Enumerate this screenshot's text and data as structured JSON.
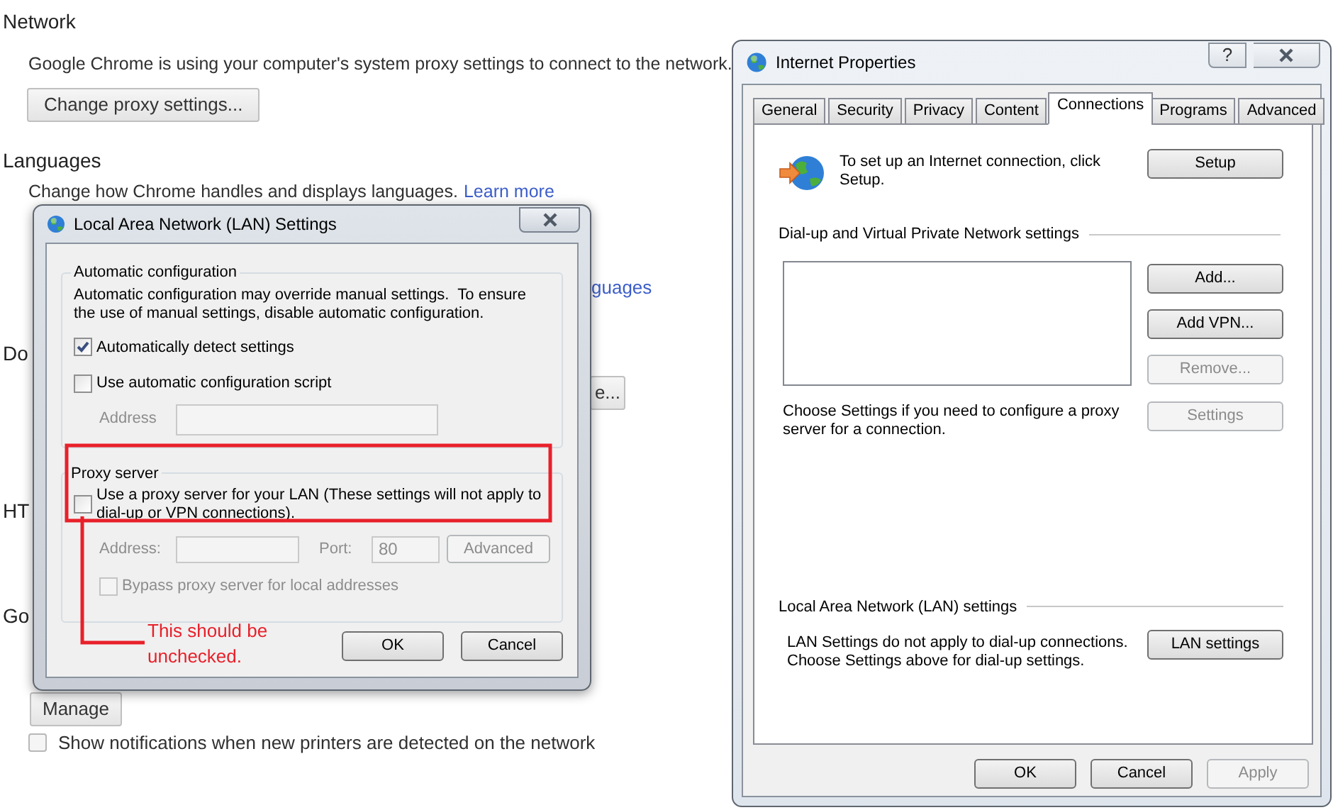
{
  "chrome_page": {
    "network": {
      "heading": "Network",
      "description": "Google Chrome is using your computer's system proxy settings to connect to the network.",
      "button": "Change proxy settings..."
    },
    "languages": {
      "heading": "Languages",
      "description": "Change how Chrome handles and displays languages.",
      "link": "Learn more"
    },
    "partial_texts": [
      {
        "kind": "link",
        "text": "guages"
      },
      {
        "kind": "heading",
        "text": "Do"
      },
      {
        "kind": "button",
        "text": "e..."
      },
      {
        "kind": "heading",
        "text": "HT"
      },
      {
        "kind": "heading",
        "text": "Go"
      },
      {
        "kind": "button",
        "text": "Manage"
      }
    ],
    "printer_notifications": {
      "label": "Show notifications when new printers are detected on the network",
      "checked": false
    }
  },
  "lan_dialog": {
    "title": "Local Area Network (LAN) Settings",
    "automatic_configuration": {
      "legend": "Automatic configuration",
      "description": "Automatic configuration may override manual settings.  To ensure the use of manual settings, disable automatic configuration.",
      "options": [
        {
          "label": "Automatically detect settings",
          "checked": true
        },
        {
          "label": "Use automatic configuration script",
          "checked": false
        }
      ],
      "address": {
        "label": "Address",
        "disabled": true
      }
    },
    "proxy_server": {
      "legend": "Proxy server",
      "use_proxy": {
        "label": "Use a proxy server for your LAN (These settings will not apply to dial-up or VPN connections).",
        "checked": false
      },
      "address": {
        "label": "Address:",
        "disabled": true
      },
      "port": {
        "label": "Port:",
        "value": "80",
        "disabled": true
      },
      "advanced_button": {
        "label": "Advanced",
        "disabled": true
      },
      "bypass": {
        "label": "Bypass proxy server for local addresses",
        "checked": false,
        "disabled": true
      }
    },
    "buttons": [
      {
        "label": "OK",
        "disabled": false
      },
      {
        "label": "Cancel",
        "disabled": false
      }
    ]
  },
  "annotation": {
    "note": "This should be unchecked."
  },
  "internet_properties": {
    "title": "Internet Properties",
    "help_button": "?",
    "tabs": [
      {
        "label": "General",
        "selected": false
      },
      {
        "label": "Security",
        "selected": false
      },
      {
        "label": "Privacy",
        "selected": false
      },
      {
        "label": "Content",
        "selected": false
      },
      {
        "label": "Connections",
        "selected": true
      },
      {
        "label": "Programs",
        "selected": false
      },
      {
        "label": "Advanced",
        "selected": false
      }
    ],
    "setup": {
      "text": "To set up an Internet connection, click Setup.",
      "button": "Setup"
    },
    "dialup": {
      "heading": "Dial-up and Virtual Private Network settings",
      "buttons": [
        {
          "label": "Add...",
          "disabled": false
        },
        {
          "label": "Add VPN...",
          "disabled": false
        },
        {
          "label": "Remove...",
          "disabled": true
        }
      ],
      "note": "Choose Settings if you need to configure a proxy server for a connection.",
      "settings_button": {
        "label": "Settings",
        "disabled": true
      }
    },
    "lan": {
      "heading": "Local Area Network (LAN) settings",
      "note_lines": [
        "LAN Settings do not apply to dial-up connections.",
        "Choose Settings above for dial-up settings."
      ],
      "button": "LAN settings"
    },
    "buttons": [
      {
        "label": "OK",
        "disabled": false
      },
      {
        "label": "Cancel",
        "disabled": false
      },
      {
        "label": "Apply",
        "disabled": true
      }
    ]
  }
}
